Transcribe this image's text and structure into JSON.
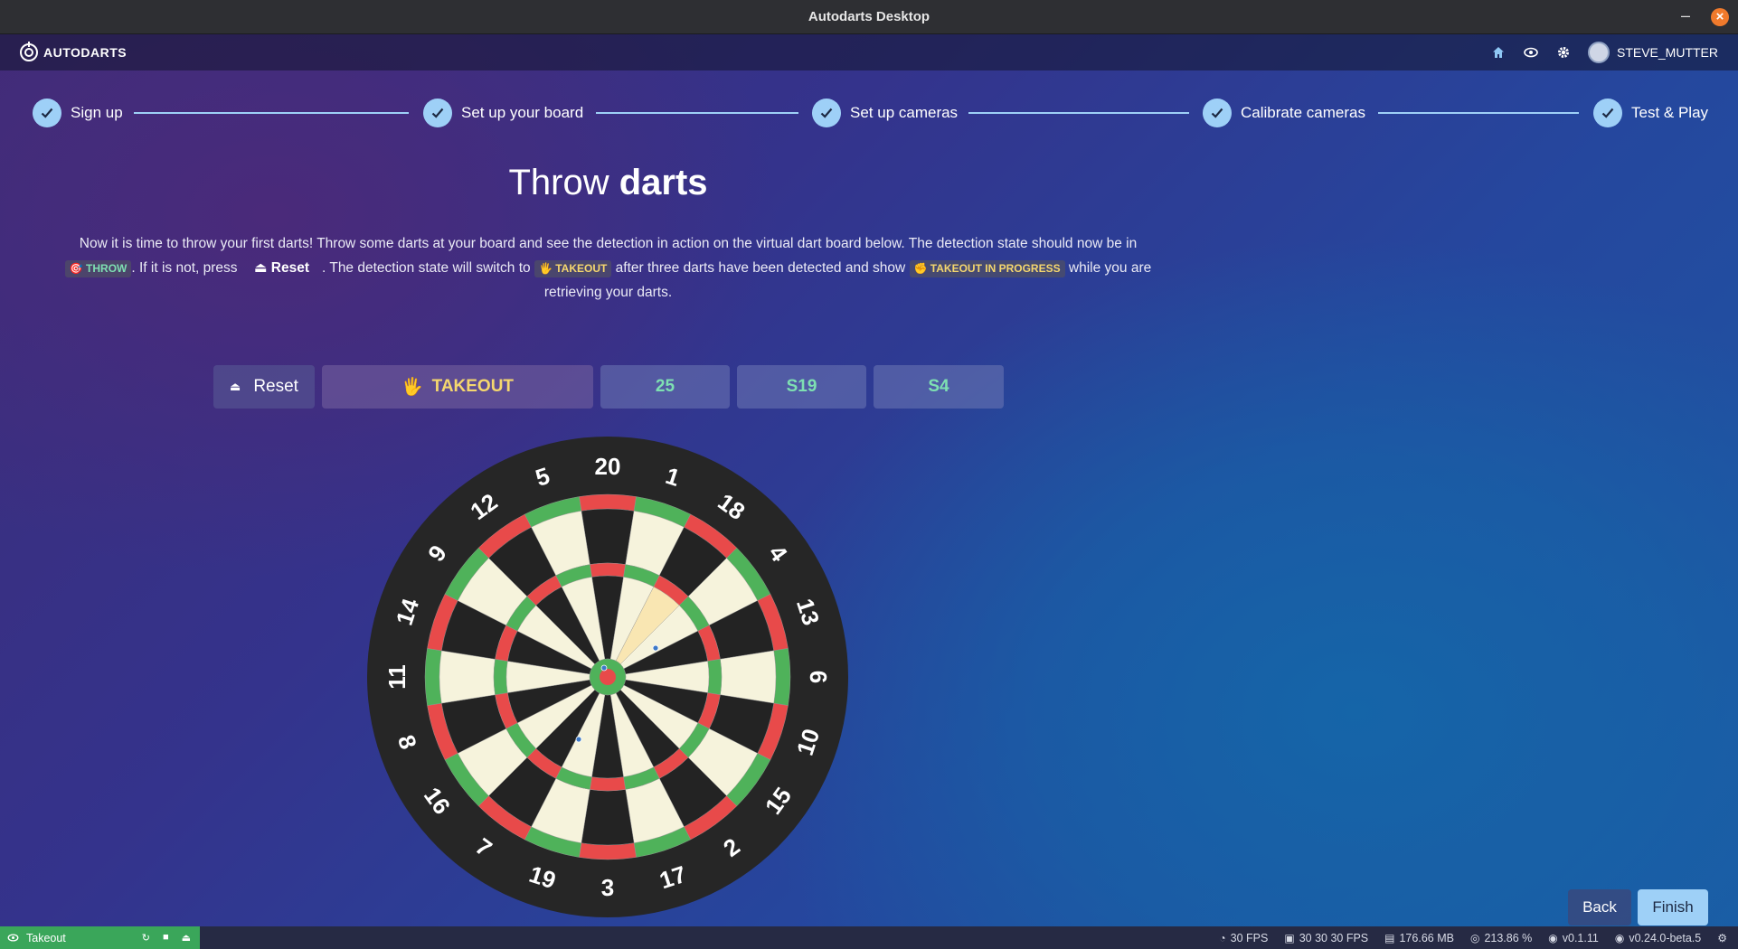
{
  "window": {
    "title": "Autodarts Desktop",
    "minimize_glyph": "–",
    "close_glyph": "×"
  },
  "header": {
    "logo_text": "AUTODARTS",
    "username": "STEVE_MUTTER",
    "icons": [
      "home-icon",
      "eye-icon",
      "gear-icon"
    ]
  },
  "stepper": {
    "steps": [
      {
        "label": "Sign up",
        "done": true
      },
      {
        "label": "Set up your board",
        "done": true
      },
      {
        "label": "Set up cameras",
        "done": true
      },
      {
        "label": "Calibrate cameras",
        "done": true
      },
      {
        "label": "Test & Play",
        "done": true
      }
    ]
  },
  "content": {
    "heading_light": "Throw",
    "heading_bold": "darts",
    "desc_part1": "Now it is time to throw your first darts! Throw some darts at your board and see the detection in action on the virtual dart board below. The detection state should now be in",
    "chip_throw": "🎯 THROW",
    "desc_part2": ". If it is not, press",
    "inline_reset": "⏏  Reset",
    "desc_part3": ". The detection state will switch to",
    "chip_takeout": "🖐 TAKEOUT",
    "desc_part4": "after three darts have been detected and show",
    "chip_progress": "✊ TAKEOUT IN PROGRESS",
    "desc_part5": "while you are retrieving your darts."
  },
  "controls": {
    "reset_label": "Reset",
    "reset_glyph": "⏏",
    "takeout_label": "TAKEOUT",
    "takeout_glyph": "🖐",
    "scores": [
      "25",
      "S19",
      "S4"
    ]
  },
  "board": {
    "numbers": [
      20,
      1,
      18,
      4,
      13,
      6,
      10,
      15,
      2,
      17,
      3,
      19,
      7,
      16,
      8,
      11,
      14,
      9,
      12,
      5
    ],
    "highlighted_segment": 18,
    "colors": {
      "black": "#232323",
      "cream": "#f6f3dc",
      "red": "#e84a4a",
      "green": "#4fb25a",
      "surround": "#262626",
      "highlight": "#f9e6b2",
      "dart": "#3c78c8"
    }
  },
  "nav": {
    "back_label": "Back",
    "finish_label": "Finish"
  },
  "statusbar": {
    "state": "Takeout",
    "fps": "30 FPS",
    "cam_fps": "30 30 30 FPS",
    "memory": "176.66 MB",
    "cpu": "213.86 %",
    "client_version": "v0.1.11",
    "board_version": "v0.24.0-beta.5"
  }
}
